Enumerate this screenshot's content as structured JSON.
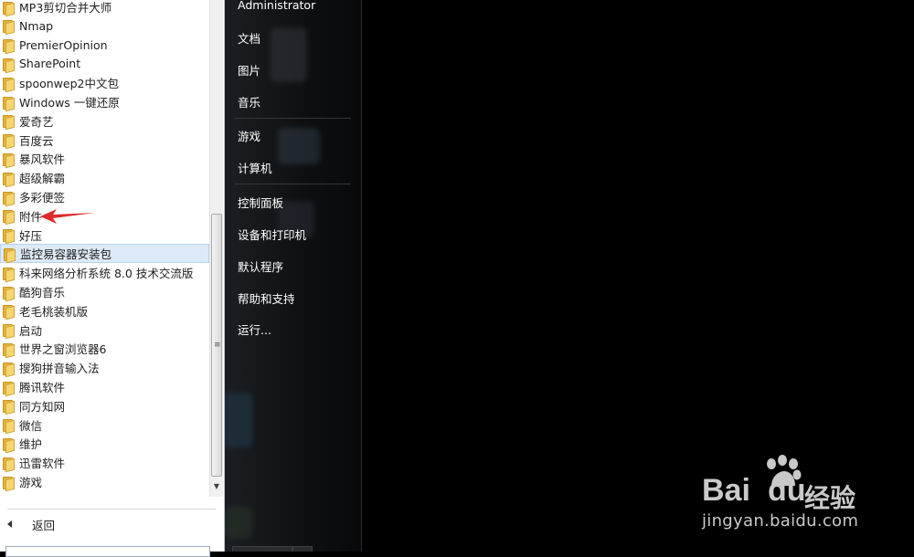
{
  "programs": {
    "items": [
      {
        "label": "MP3剪切合并大师"
      },
      {
        "label": "Nmap"
      },
      {
        "label": "PremierOpinion"
      },
      {
        "label": "SharePoint"
      },
      {
        "label": "spoonwep2中文包"
      },
      {
        "label": "Windows 一键还原"
      },
      {
        "label": "爱奇艺"
      },
      {
        "label": "百度云"
      },
      {
        "label": "暴风软件"
      },
      {
        "label": "超级解霸"
      },
      {
        "label": "多彩便签"
      },
      {
        "label": "附件"
      },
      {
        "label": "好压"
      },
      {
        "label": "监控易容器安装包"
      },
      {
        "label": "科来网络分析系统 8.0 技术交流版"
      },
      {
        "label": "酷狗音乐"
      },
      {
        "label": "老毛桃装机版"
      },
      {
        "label": "启动"
      },
      {
        "label": "世界之窗浏览器6"
      },
      {
        "label": "搜狗拼音输入法"
      },
      {
        "label": "腾讯软件"
      },
      {
        "label": "同方知网"
      },
      {
        "label": "微信"
      },
      {
        "label": "维护"
      },
      {
        "label": "迅雷软件"
      },
      {
        "label": "游戏"
      }
    ],
    "highlighted_index": 13,
    "back_label": "返回"
  },
  "right_menu": {
    "user": "Administrator",
    "items": [
      {
        "label": "文档"
      },
      {
        "label": "图片"
      },
      {
        "label": "音乐"
      },
      {
        "label": "游戏"
      },
      {
        "label": "计算机"
      },
      {
        "label": "控制面板"
      },
      {
        "label": "设备和打印机"
      },
      {
        "label": "默认程序"
      },
      {
        "label": "帮助和支持"
      },
      {
        "label": "运行..."
      }
    ]
  },
  "watermark": {
    "bai": "Bai",
    "du": "du",
    "jingyan": "经验",
    "url": "jingyan.baidu.com"
  },
  "colors": {
    "annotation_arrow": "#e02a2a",
    "highlight": "#dce9f7"
  }
}
